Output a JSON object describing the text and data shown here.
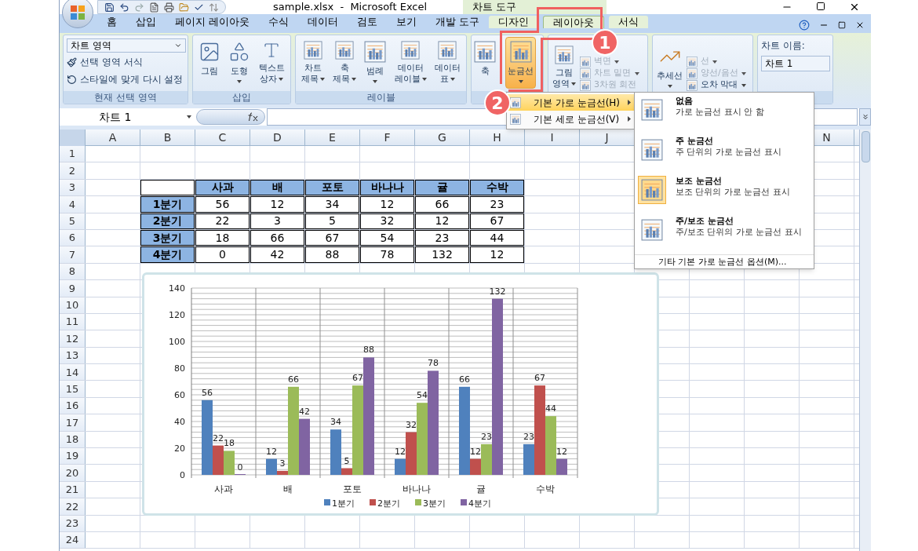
{
  "title_bar": {
    "title": "sample.xlsx  -  Microsoft Excel",
    "tool_group": "차트 도구"
  },
  "ribbon_tabs": [
    {
      "label": "홈",
      "selected": false,
      "contextual": false
    },
    {
      "label": "삽입",
      "selected": false,
      "contextual": false
    },
    {
      "label": "페이지 레이아웃",
      "selected": false,
      "contextual": false
    },
    {
      "label": "수식",
      "selected": false,
      "contextual": false
    },
    {
      "label": "데이터",
      "selected": false,
      "contextual": false
    },
    {
      "label": "검토",
      "selected": false,
      "contextual": false
    },
    {
      "label": "보기",
      "selected": false,
      "contextual": false
    },
    {
      "label": "개발 도구",
      "selected": false,
      "contextual": false
    },
    {
      "label": "디자인",
      "selected": false,
      "contextual": true
    },
    {
      "label": "레이아웃",
      "selected": true,
      "contextual": true
    },
    {
      "label": "서식",
      "selected": false,
      "contextual": true
    }
  ],
  "ribbon_groups": [
    {
      "kind": "selection",
      "label": "현재 선택 영역",
      "dropdown": "차트 영역",
      "items": [
        {
          "label": "선택 영역 서식"
        },
        {
          "label": "스타일에 맞게 다시 설정"
        }
      ]
    },
    {
      "kind": "buttons",
      "label": "삽입",
      "buttons": [
        {
          "lines": [
            "그림"
          ],
          "menu": false,
          "selected": false
        },
        {
          "lines": [
            "도형"
          ],
          "menu": true,
          "selected": false
        },
        {
          "lines": [
            "텍스트",
            "상자"
          ],
          "menu": true,
          "selected": false
        }
      ]
    },
    {
      "kind": "buttons",
      "label": "레이블",
      "buttons": [
        {
          "lines": [
            "차트",
            "제목"
          ],
          "menu": true,
          "selected": false
        },
        {
          "lines": [
            "축",
            "제목"
          ],
          "menu": true,
          "selected": false
        },
        {
          "lines": [
            "범례"
          ],
          "menu": true,
          "selected": false
        },
        {
          "lines": [
            "데이터",
            "레이블"
          ],
          "menu": true,
          "selected": false
        },
        {
          "lines": [
            "데이터",
            "표"
          ],
          "menu": true,
          "selected": false
        }
      ]
    },
    {
      "kind": "buttons",
      "buttons": [
        {
          "lines": [
            "축"
          ],
          "menu": false,
          "selected": false
        },
        {
          "lines": [
            "눈금선"
          ],
          "menu": true,
          "selected": true
        }
      ]
    },
    {
      "kind": "mixed",
      "large": {
        "lines": [
          "그림",
          "영역"
        ],
        "menu": true
      },
      "small": [
        {
          "label": "벽면",
          "menu": true,
          "disabled": true
        },
        {
          "label": "차트 밑면",
          "menu": true,
          "disabled": true
        },
        {
          "label": "3차원 회전",
          "menu": false,
          "disabled": true
        }
      ]
    },
    {
      "kind": "mixed",
      "large": {
        "lines": [
          "추세선"
        ],
        "menu": true
      },
      "small": [
        {
          "label": "선",
          "menu": true,
          "disabled": true
        },
        {
          "label": "양선/음선",
          "menu": true,
          "disabled": true
        },
        {
          "label": "오차 막대",
          "menu": true,
          "disabled": false
        }
      ]
    },
    {
      "kind": "field",
      "caption": "차트 이름:",
      "value": "차트 1"
    }
  ],
  "formula_bar": {
    "name_box": "차트 1"
  },
  "columns": [
    {
      "label": "A"
    },
    {
      "label": "B"
    },
    {
      "label": "C"
    },
    {
      "label": "D"
    },
    {
      "label": "E"
    },
    {
      "label": "F"
    },
    {
      "label": "G"
    },
    {
      "label": "H"
    },
    {
      "label": "I"
    },
    {
      "label": "J"
    },
    {},
    {},
    {},
    {
      "label": "N"
    }
  ],
  "rows": [
    "1",
    "2",
    "3",
    "4",
    "5",
    "6",
    "7",
    "8",
    "9",
    "10",
    "11",
    "12",
    "13",
    "14",
    "15",
    "16",
    "17",
    "18",
    "19",
    "20",
    "21",
    "22",
    "23",
    "24"
  ],
  "table": {
    "header": [
      "사과",
      "배",
      "포토",
      "바나나",
      "귤",
      "수박"
    ],
    "rows": [
      {
        "label": "1분기",
        "values": [
          "56",
          "12",
          "34",
          "12",
          "66",
          "23"
        ]
      },
      {
        "label": "2분기",
        "values": [
          "22",
          "3",
          "5",
          "32",
          "12",
          "67"
        ]
      },
      {
        "label": "3분기",
        "values": [
          "18",
          "66",
          "67",
          "54",
          "23",
          "44"
        ]
      },
      {
        "label": "4분기",
        "values": [
          "0",
          "42",
          "88",
          "78",
          "132",
          "12"
        ]
      }
    ]
  },
  "chart_data": {
    "type": "bar",
    "categories": [
      "사과",
      "배",
      "포토",
      "바나나",
      "귤",
      "수박"
    ],
    "series": [
      {
        "name": "1분기",
        "color": "#4f81bd",
        "values": [
          56,
          12,
          34,
          12,
          66,
          23
        ]
      },
      {
        "name": "2분기",
        "color": "#c0504d",
        "values": [
          22,
          3,
          5,
          32,
          12,
          67
        ]
      },
      {
        "name": "3분기",
        "color": "#9bbb59",
        "values": [
          18,
          66,
          67,
          54,
          23,
          44
        ]
      },
      {
        "name": "4분기",
        "color": "#8064a2",
        "values": [
          0,
          42,
          88,
          78,
          132,
          12
        ]
      }
    ],
    "ylim": [
      0,
      140
    ],
    "yticks": [
      {
        "value": 0,
        "label": "0"
      },
      {
        "value": 20,
        "label": "20"
      },
      {
        "value": 40,
        "label": "40"
      },
      {
        "value": 60,
        "label": "60"
      },
      {
        "value": 80,
        "label": "80"
      },
      {
        "value": 100,
        "label": "100"
      },
      {
        "value": 120,
        "label": "120"
      },
      {
        "value": 140,
        "label": "140"
      }
    ],
    "value_labels": [
      [
        "56",
        "12",
        "34",
        "12",
        "66",
        "23"
      ],
      [
        "22",
        "3",
        "5",
        "32",
        "12",
        "67"
      ],
      [
        "18",
        "66",
        "67",
        "54",
        "23",
        "44"
      ],
      [
        "0",
        "42",
        "88",
        "78",
        "132",
        "12"
      ]
    ],
    "grid": true,
    "legend": true
  },
  "gridline_menu": [
    {
      "label": "기본 가로 눈금선(H)",
      "selected": true
    },
    {
      "label": "기본 세로 눈금선(V)",
      "selected": false
    }
  ],
  "gridline_options": [
    {
      "title": "없음",
      "description": "가로 눈금선 표시 안 함",
      "selected": false
    },
    {
      "title": "주 눈금선",
      "description": "주 단위의 가로 눈금선 표시",
      "selected": false
    },
    {
      "title": "보조 눈금선",
      "description": "보조 단위의 가로 눈금선 표시",
      "selected": true
    },
    {
      "title": "주/보조 눈금선",
      "description": "주/보조 단위의 가로 눈금선 표시",
      "selected": false
    }
  ],
  "more_options": "기타 기본 가로 눈금선 옵션(M)...",
  "callouts": [
    "1",
    "2"
  ]
}
